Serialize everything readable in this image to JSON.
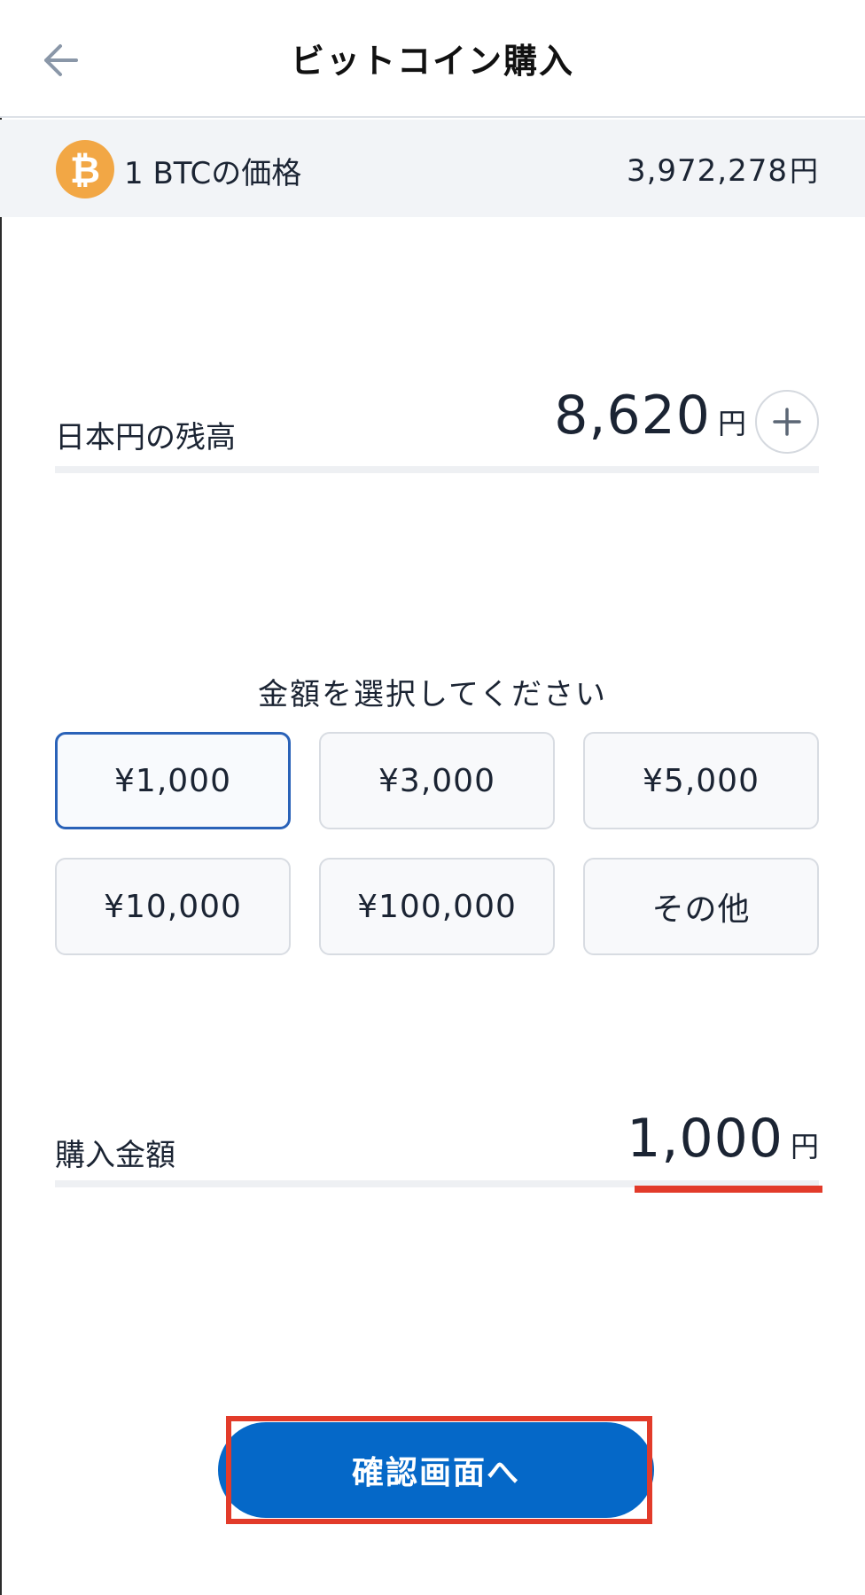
{
  "header": {
    "title": "ビットコイン購入",
    "back_icon": "arrow-left-icon"
  },
  "price_bar": {
    "coin_icon": "bitcoin-icon",
    "coin_symbol": "₿",
    "label": "1 BTCの価格",
    "value": "3,972,278",
    "unit": "円"
  },
  "balance": {
    "label": "日本円の残高",
    "value": "8,620",
    "unit": "円",
    "add_icon": "plus-icon"
  },
  "amount_select": {
    "title": "金額を選択してください",
    "options": [
      {
        "label": "¥1,000",
        "selected": true
      },
      {
        "label": "¥3,000",
        "selected": false
      },
      {
        "label": "¥5,000",
        "selected": false
      },
      {
        "label": "¥10,000",
        "selected": false
      },
      {
        "label": "¥100,000",
        "selected": false
      },
      {
        "label": "その他",
        "selected": false
      }
    ]
  },
  "purchase": {
    "label": "購入金額",
    "value": "1,000",
    "unit": "円"
  },
  "confirm_button": {
    "label": "確認画面へ"
  },
  "colors": {
    "accent_blue": "#0568c8",
    "selected_border": "#2a62b8",
    "highlight_red": "#e23b2a",
    "bitcoin_orange": "#f2a745"
  }
}
